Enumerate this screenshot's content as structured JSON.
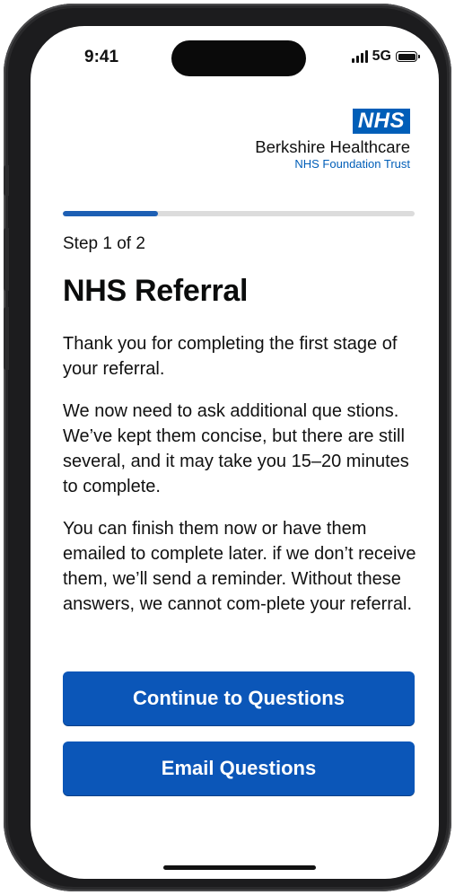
{
  "status_bar": {
    "time": "9:41",
    "network": "5G"
  },
  "header": {
    "logo_text": "NHS",
    "org_name": "Berkshire Healthcare",
    "org_subtitle": "NHS Foundation Trust",
    "brand_color": "#005eb8"
  },
  "progress": {
    "step_label": "Step 1 of 2",
    "fraction": 0.27
  },
  "main": {
    "title": "NHS Referral",
    "paragraphs": [
      "Thank you for completing the first stage of your referral.",
      "We now need to ask additional que stions. We’ve kept them concise, but there are still several, and it may take you 15–20 minutes to complete.",
      "You can finish them now or have them emailed to complete later. if we don’t receive them, we’ll send a reminder. Without these answers, we cannot com-plete your referral."
    ]
  },
  "actions": {
    "continue_label": "Continue to Questions",
    "email_label": "Email Questions",
    "button_color": "#0b56b8"
  }
}
